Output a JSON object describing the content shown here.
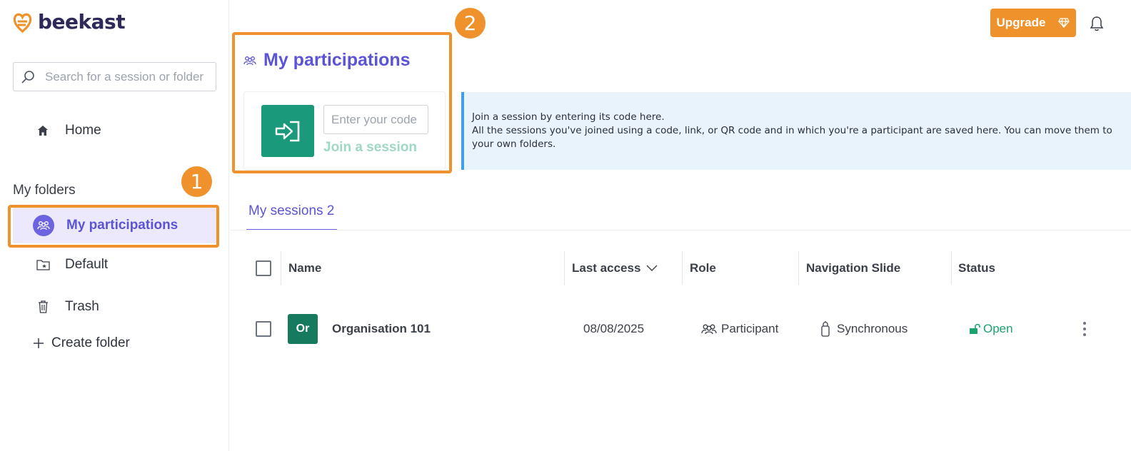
{
  "app": {
    "logo_text": "beekast"
  },
  "sidebar": {
    "search_placeholder": "Search for a session or folder",
    "home_label": "Home",
    "folders_heading": "My folders",
    "items": [
      {
        "label": "My participations",
        "icon": "participants-icon",
        "active": true
      },
      {
        "label": "Default",
        "icon": "folder-star-icon",
        "active": false
      },
      {
        "label": "Trash",
        "icon": "trash-icon",
        "active": false
      }
    ],
    "create_folder_label": "Create folder"
  },
  "annotations": {
    "badge1": "1",
    "badge2": "2"
  },
  "header": {
    "upgrade_label": "Upgrade"
  },
  "participations": {
    "title": "My participations",
    "code_placeholder": "Enter your code",
    "join_label": "Join a session"
  },
  "info": {
    "line1": "Join a session by entering its code here.",
    "line2": "All the sessions you've joined using a code, link, or QR code and in which you're a participant are saved here. You can move them to your own folders."
  },
  "tabs": {
    "sessions_label": "My sessions 2"
  },
  "table": {
    "columns": [
      "Name",
      "Last access",
      "Role",
      "Navigation Slide",
      "Status"
    ],
    "rows": [
      {
        "avatar": "Or",
        "name": "Organisation 101",
        "last_access": "08/08/2025",
        "role": "Participant",
        "navigation": "Synchronous",
        "status": "Open"
      }
    ]
  },
  "colors": {
    "accent": "#5b54d6",
    "orange": "#f0922b",
    "green": "#1a9a7a",
    "info_bg": "#e8f3fc"
  }
}
